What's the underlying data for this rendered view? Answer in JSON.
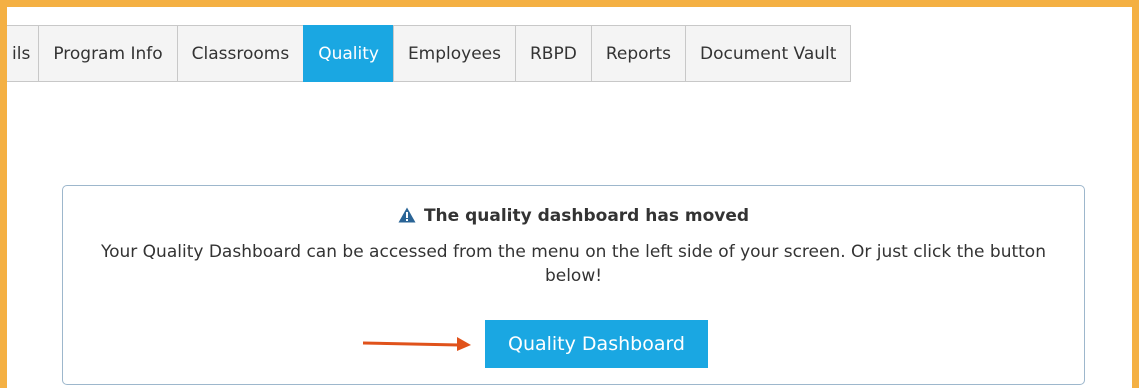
{
  "tabs": [
    {
      "label": "ils"
    },
    {
      "label": "Program Info"
    },
    {
      "label": "Classrooms"
    },
    {
      "label": "Quality",
      "active": true
    },
    {
      "label": "Employees"
    },
    {
      "label": "RBPD"
    },
    {
      "label": "Reports"
    },
    {
      "label": "Document Vault"
    }
  ],
  "notice": {
    "title": "The quality dashboard has moved",
    "body": "Your Quality Dashboard can be accessed from the menu on the left side of your screen. Or just click the button below!",
    "button_label": "Quality Dashboard",
    "icon": "warning-triangle-icon"
  },
  "colors": {
    "frame_border": "#f4b043",
    "active_tab": "#1aa7e2",
    "button": "#1aa7e2",
    "arrow": "#e0521b",
    "warning_icon": "#2a6496"
  }
}
